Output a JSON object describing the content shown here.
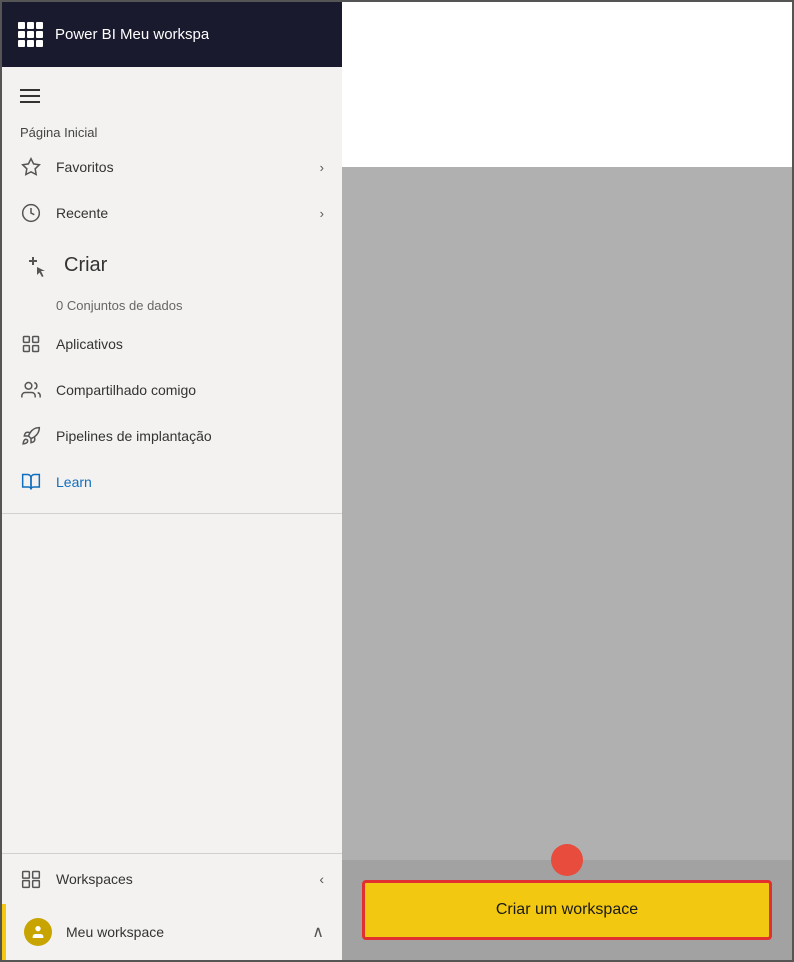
{
  "header": {
    "title": "Power BI Meu workspa",
    "grid_icon_label": "apps-grid-icon"
  },
  "sidebar": {
    "hamburger_label": "hamburger-menu",
    "nav_section_label": "Página Inicial",
    "items": [
      {
        "id": "favoritos",
        "label": "Favoritos",
        "has_chevron": true,
        "icon": "star-icon"
      },
      {
        "id": "recente",
        "label": "Recente",
        "has_chevron": true,
        "icon": "clock-icon"
      },
      {
        "id": "criar",
        "label": "Criar",
        "has_chevron": false,
        "icon": "plus-cursor-icon",
        "is_large": true
      },
      {
        "id": "datasets",
        "label": "0 Conjuntos de dados",
        "is_sub": true
      },
      {
        "id": "aplicativos",
        "label": "Aplicativos",
        "has_chevron": false,
        "icon": "apps-icon"
      },
      {
        "id": "compartilhado",
        "label": "Compartilhado comigo",
        "has_chevron": false,
        "icon": "shared-icon"
      },
      {
        "id": "pipelines",
        "label": "Pipelines de implantação",
        "has_chevron": false,
        "icon": "rocket-icon"
      },
      {
        "id": "learn",
        "label": "Learn",
        "has_chevron": false,
        "icon": "book-icon",
        "is_learn": true
      }
    ],
    "bottom": {
      "workspaces_label": "Workspaces",
      "meu_workspace_label": "Meu workspace"
    }
  },
  "main": {
    "create_button_label": "Criar um workspace"
  }
}
